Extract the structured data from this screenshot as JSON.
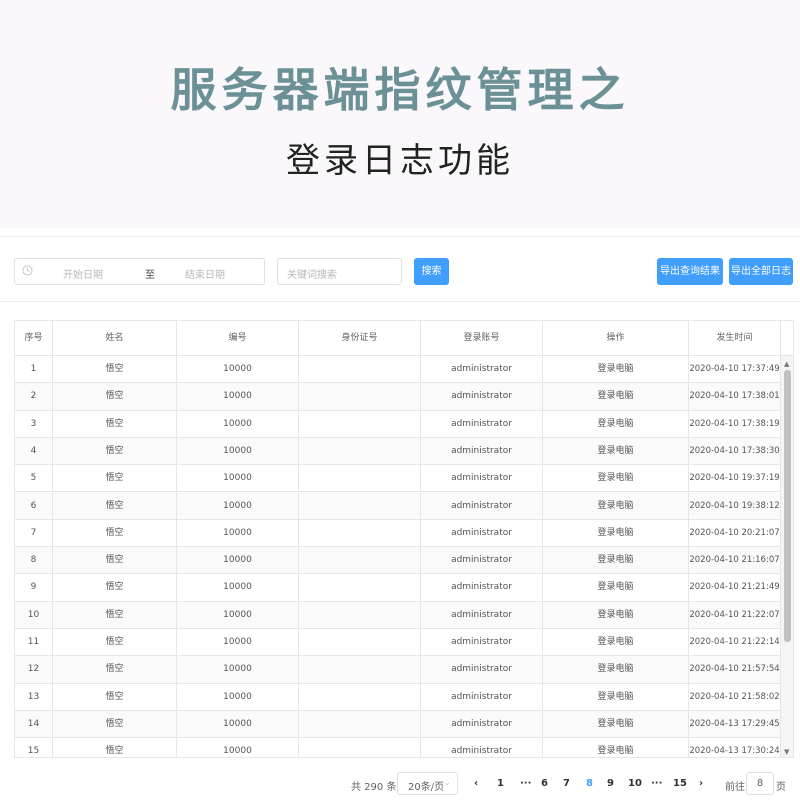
{
  "hero": {
    "title": "服务器端指纹管理之",
    "subtitle": "登录日志功能"
  },
  "toolbar": {
    "start_placeholder": "开始日期",
    "range_sep": "至",
    "end_placeholder": "结束日期",
    "keyword_placeholder": "关键词搜索",
    "search_label": "搜索",
    "export_query_label": "导出查询结果",
    "export_all_label": "导出全部日志",
    "accent_color": "#409eff"
  },
  "table": {
    "headers": [
      "序号",
      "姓名",
      "编号",
      "身份证号",
      "登录账号",
      "操作",
      "发生时间"
    ],
    "rows": [
      [
        "1",
        "悟空",
        "10000",
        "",
        "administrator",
        "登录电脑",
        "2020-04-10 17:37:49"
      ],
      [
        "2",
        "悟空",
        "10000",
        "",
        "administrator",
        "登录电脑",
        "2020-04-10 17:38:01"
      ],
      [
        "3",
        "悟空",
        "10000",
        "",
        "administrator",
        "登录电脑",
        "2020-04-10 17:38:19"
      ],
      [
        "4",
        "悟空",
        "10000",
        "",
        "administrator",
        "登录电脑",
        "2020-04-10 17:38:30"
      ],
      [
        "5",
        "悟空",
        "10000",
        "",
        "administrator",
        "登录电脑",
        "2020-04-10 19:37:19"
      ],
      [
        "6",
        "悟空",
        "10000",
        "",
        "administrator",
        "登录电脑",
        "2020-04-10 19:38:12"
      ],
      [
        "7",
        "悟空",
        "10000",
        "",
        "administrator",
        "登录电脑",
        "2020-04-10 20:21:07"
      ],
      [
        "8",
        "悟空",
        "10000",
        "",
        "administrator",
        "登录电脑",
        "2020-04-10 21:16:07"
      ],
      [
        "9",
        "悟空",
        "10000",
        "",
        "administrator",
        "登录电脑",
        "2020-04-10 21:21:49"
      ],
      [
        "10",
        "悟空",
        "10000",
        "",
        "administrator",
        "登录电脑",
        "2020-04-10 21:22:07"
      ],
      [
        "11",
        "悟空",
        "10000",
        "",
        "administrator",
        "登录电脑",
        "2020-04-10 21:22:14"
      ],
      [
        "12",
        "悟空",
        "10000",
        "",
        "administrator",
        "登录电脑",
        "2020-04-10 21:57:54"
      ],
      [
        "13",
        "悟空",
        "10000",
        "",
        "administrator",
        "登录电脑",
        "2020-04-10 21:58:02"
      ],
      [
        "14",
        "悟空",
        "10000",
        "",
        "administrator",
        "登录电脑",
        "2020-04-13 17:29:45"
      ],
      [
        "15",
        "悟空",
        "10000",
        "",
        "administrator",
        "登录电脑",
        "2020-04-13 17:30:24"
      ]
    ]
  },
  "pagination": {
    "total": "共 290 条",
    "page_size": "20条/页",
    "prev": "‹",
    "pages": [
      "1",
      "···",
      "6",
      "7",
      "8",
      "9",
      "10",
      "···",
      "15"
    ],
    "current": "8",
    "next": "›",
    "goto_label": "前往",
    "goto_value": "8",
    "page_unit": "页"
  }
}
